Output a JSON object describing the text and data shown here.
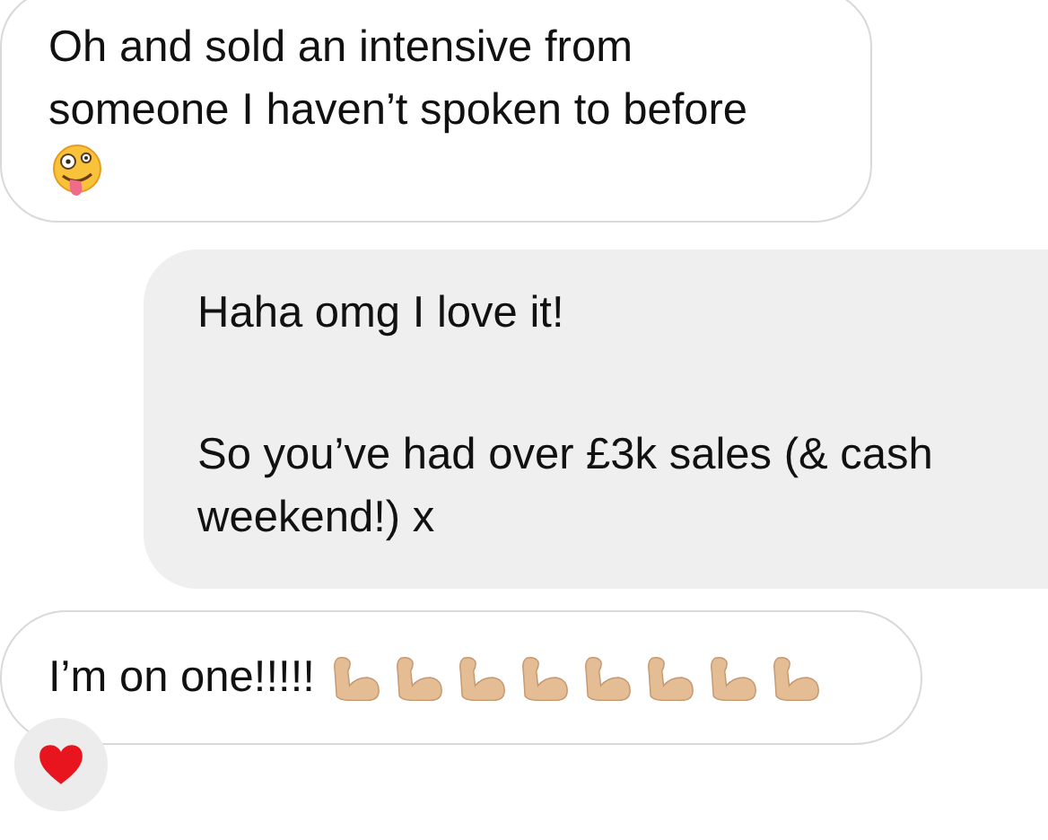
{
  "messages": [
    {
      "kind": "received",
      "paragraphs": [
        "Oh and sold an intensive from someone I haven’t spoken to before"
      ],
      "emojis": [
        {
          "kind": "zany-face"
        }
      ],
      "reaction": false
    },
    {
      "kind": "sent",
      "paragraphs": [
        "Haha omg I love it!",
        "So you’ve had over £3k sales (& cash weekend!) x"
      ],
      "reaction": false
    },
    {
      "kind": "received",
      "paragraphs": [
        "I’m on one!!!!!"
      ],
      "emojis": [
        {
          "kind": "flexed-arm"
        },
        {
          "kind": "flexed-arm"
        },
        {
          "kind": "flexed-arm"
        },
        {
          "kind": "flexed-arm"
        },
        {
          "kind": "flexed-arm"
        },
        {
          "kind": "flexed-arm"
        },
        {
          "kind": "flexed-arm"
        },
        {
          "kind": "flexed-arm"
        }
      ],
      "reaction": true
    }
  ]
}
